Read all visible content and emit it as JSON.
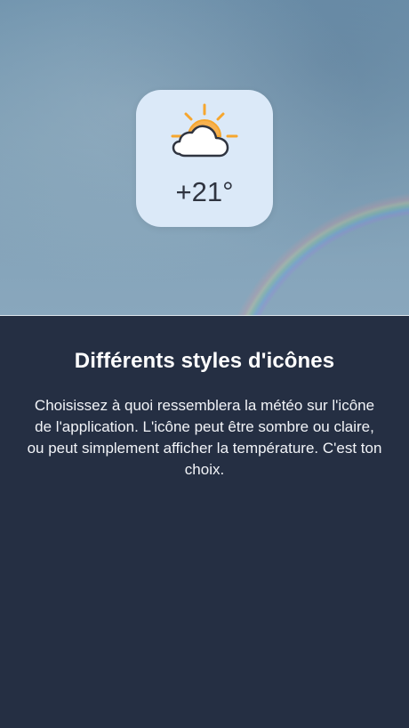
{
  "hero": {
    "weather_card": {
      "temperature": "+21°",
      "icon": "partly-cloudy-sun-icon",
      "colors": {
        "card_background": "#dbe9f8",
        "sun": "#f6a62e",
        "cloud": "#ffffff",
        "text": "#2f3440"
      }
    }
  },
  "content": {
    "title": "Différents styles d'icônes",
    "description": "Choisissez à quoi ressemblera la météo sur l'icône de l'application. L'icône peut être sombre ou claire, ou peut simplement afficher la température. C'est ton choix."
  },
  "colors": {
    "page_background": "#252f43",
    "title": "#ffffff",
    "description": "#f2f4f8"
  }
}
